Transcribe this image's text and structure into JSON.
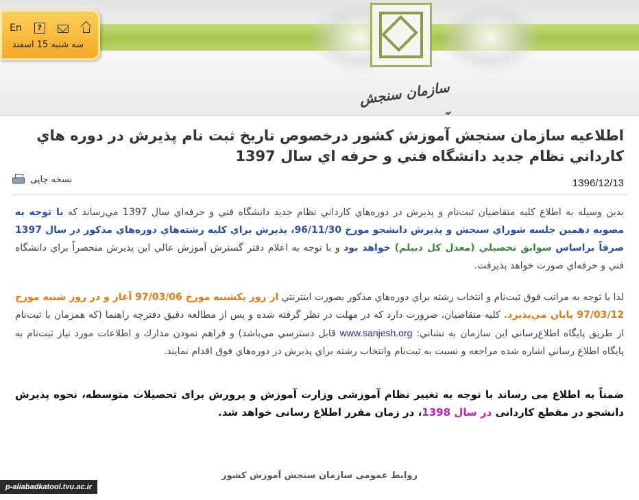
{
  "top_box": {
    "lang_label": "En",
    "help_icon": "help-icon",
    "mail_icon": "mail-icon",
    "home_icon": "home-icon",
    "date": "سه شنبه 15 اسفند"
  },
  "header": {
    "org_name": "سازمان سنجش آموزش کشور",
    "logo_icon": "organization-logo"
  },
  "article": {
    "title": "اطلاعیه سازمان سنجش آموزش کشور درخصوص تاریخ ثبت نام پذیرش در دوره هاي کارداني نظام جدید دانشگاه فني و حرفه اي سال 1397",
    "print_label": "نسخه چاپی",
    "print_icon": "printer-icon",
    "date": "1396/12/13",
    "p1": {
      "t1": "بدين وسيله به اطلاع كليه متقاضيان ثبت‌نام و پذيرش در دوره‌هاي كارداني نظام جديد دانشگاه فني و حرفه‌اي سال 1397 مي‌رساند كه ",
      "t2": "با توجه به مصوبه دهمين جلسه شوراي سنجش و پذيرش دانشجو مورخ 96/11/30، پذيرش براي كليه رشته‌هاي دوره‌هاي مذكور در سال 1397 صرفاً براساس",
      "t3": " سوابق تحصيلي (معدل كل ديپلم) ",
      "t4": "خواهد بود",
      "t5": " و با توجه به اعلام دفتر گسترش آموزش عالي اين پذيرش منحصراً براي دانشگاه فني و حرفه‌اي صورت خواهد پذيرفت."
    },
    "p2": {
      "t1": "لذا با توجه به مراتب فوق ثبت‌نام و انتخاب رشته براي دوره‌هاي مذكور بصورت اينترنتي ",
      "t2": "از روز يكشنبه مورخ 97/03/06 آغاز و در روز شنبه مورخ 97/03/12 پايان مي‌پذيرد.",
      "t3": " كليه متقاضيان، ضرورت دارد كه در مهلت در نظر گرفته شده و پس از مطالعه دقيق دفترچه راهنما (كه همزمان با ثبت‌نام از طريق پايگاه اطلاع‌رساني اين سازمان به نشاني: ",
      "link": "www.sanjesh.org",
      "t4": " قابل دسترسي مي‌باشد) و فراهم نمودن مدارك و اطلاعات مورد نياز ثبت‌نام به پايگاه اطلاع رساني اشاره شده مراجعه و نسبت به ثبت‌نام وانتخاب رشته براي پذيرش در دوره‌هاي فوق اقدام نمايند."
    },
    "p3": {
      "t1": "ضمناً به اطلاع می رساند با توجه به تغییر نظام آموزشی وزارت آموزش و پرورش برای تحصیلات متوسطه، نحوه پذیرش دانشجو در مقطع کاردانی ",
      "t2": "در سال 1398",
      "t3": "، در زمان مقرر اطلاع رسانی خواهد شد."
    },
    "footer": "روابط عمومی سازمان سنجش آموزش کشور"
  },
  "watermark": "p-aliabadkatool.tvu.ac.ir"
}
